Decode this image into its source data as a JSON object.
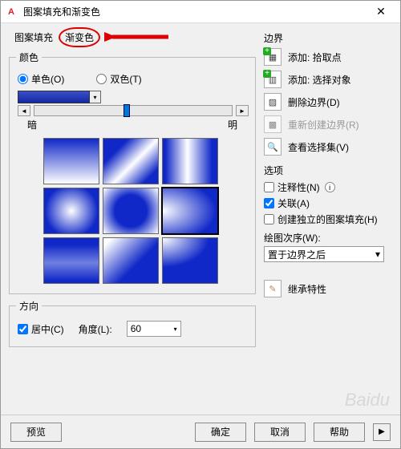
{
  "window": {
    "title": "图案填充和渐变色"
  },
  "tabs": {
    "hatch": "图案填充",
    "gradient": "渐变色"
  },
  "color_group": {
    "legend": "颜色",
    "one_color": "单色(O)",
    "two_color": "双色(T)",
    "dark": "暗",
    "light": "明"
  },
  "direction_group": {
    "legend": "方向",
    "centered": "居中(C)",
    "angle_label": "角度(L):",
    "angle_value": "60"
  },
  "boundary": {
    "title": "边界",
    "add_pick": "添加: 拾取点",
    "add_select": "添加: 选择对象",
    "remove": "删除边界(D)",
    "recreate": "重新创建边界(R)",
    "view": "查看选择集(V)"
  },
  "options": {
    "title": "选项",
    "annotative": "注释性(N)",
    "associative": "关联(A)",
    "independent": "创建独立的图案填充(H)",
    "order_label": "绘图次序(W):",
    "order_value": "置于边界之后"
  },
  "inherit": {
    "label": "继承特性"
  },
  "footer": {
    "preview": "预览",
    "ok": "确定",
    "cancel": "取消",
    "help": "帮助"
  }
}
